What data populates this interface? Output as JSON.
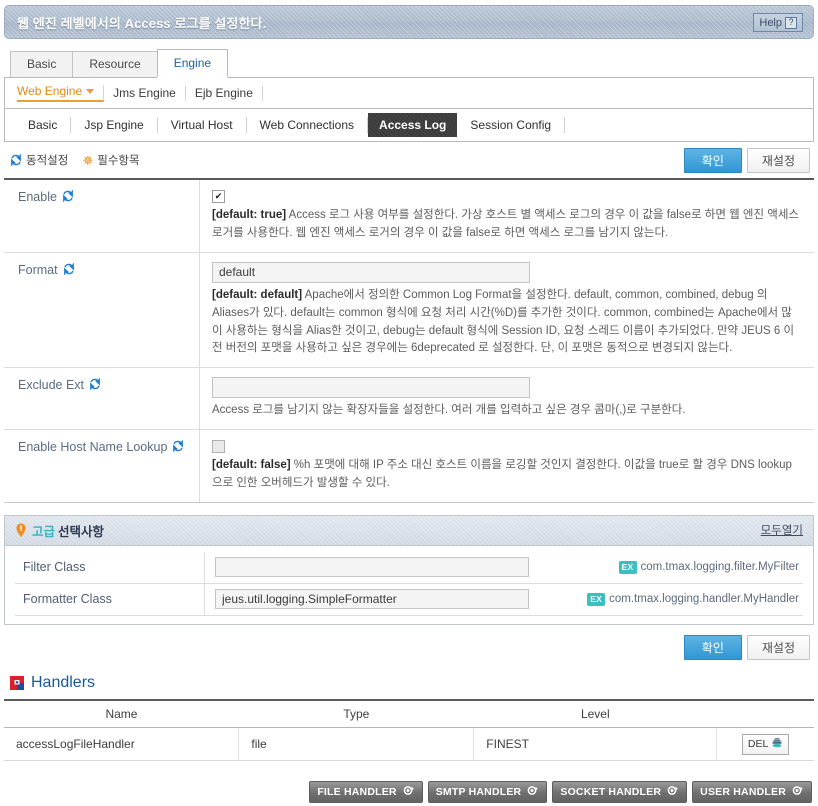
{
  "banner": {
    "title": "웹 엔진 레벨에서의 Access 로그를 설정한다.",
    "help_label": "Help",
    "help_icon_char": "?"
  },
  "main_tabs": [
    {
      "label": "Basic",
      "active": false
    },
    {
      "label": "Resource",
      "active": false
    },
    {
      "label": "Engine",
      "active": true
    }
  ],
  "engine_nav": [
    {
      "label": "Web Engine",
      "active": true
    },
    {
      "label": "Jms Engine",
      "active": false
    },
    {
      "label": "Ejb Engine",
      "active": false
    }
  ],
  "sub_tabs": [
    {
      "label": "Basic",
      "active": false
    },
    {
      "label": "Jsp Engine",
      "active": false
    },
    {
      "label": "Virtual Host",
      "active": false
    },
    {
      "label": "Web Connections",
      "active": false
    },
    {
      "label": "Access Log",
      "active": true
    },
    {
      "label": "Session Config",
      "active": false
    }
  ],
  "legend": {
    "dynamic_label": "동적설정",
    "required_label": "필수항목",
    "sync_icon": "sync-icon",
    "asterisk_icon": "asterisk-icon"
  },
  "actions": {
    "confirm_label": "확인",
    "reset_label": "재설정"
  },
  "form_rows": [
    {
      "label": "Enable",
      "control": "checkbox",
      "checked": true,
      "default_tag": "[default: true]",
      "description": "Access 로그 사용 여부를 설정한다. 가상 호스트 별 액세스 로그의 경우 이 값을 false로 하면 웹 엔진 액세스 로거를 사용한다. 웹 엔진 액세스 로거의 경우 이 값을 false로 하면 액세스 로그를 남기지 않는다."
    },
    {
      "label": "Format",
      "control": "text",
      "value": "default",
      "default_tag": "[default: default]",
      "description": "Apache에서 정의한 Common Log Format을 설정한다. default, common, combined, debug 의 Aliases가 있다. default는 common 형식에 요청 처리 시간(%D)를 추가한 것이다. common, combined는 Apache에서 많이 사용하는 형식을 Alias한 것이고, debug는 default 형식에 Session ID, 요청 스레드 이름이 추가되었다. 만약 JEUS 6 이전 버전의 포맷을 사용하고 싶은 경우에는 6deprecated 로 설정한다. 단, 이 포맷은 동적으로 변경되지 않는다."
    },
    {
      "label": "Exclude Ext",
      "control": "text",
      "value": "",
      "default_tag": "",
      "description": "Access 로그를 남기지 않는 확장자들을 설정한다. 여러 개를 입력하고 싶은 경우 콤마(,)로 구분한다."
    },
    {
      "label": "Enable Host Name Lookup",
      "control": "checkbox",
      "checked": false,
      "default_tag": "[default: false]",
      "description": "%h 포맷에 대해 IP 주소 대신 호스트 이름을 로깅할 것인지 결정한다. 이값을 true로 할 경우 DNS lookup으로 인한 오버헤드가 발생할 수 있다."
    }
  ],
  "advanced": {
    "title_accent": "고급",
    "title_rest": "선택사항",
    "open_all_label": "모두열기",
    "pin_icon": "bulb-pin-icon",
    "rows": [
      {
        "label": "Filter Class",
        "value": "",
        "hint_badge": "EX",
        "hint": "com.tmax.logging.filter.MyFilter"
      },
      {
        "label": "Formatter Class",
        "value": "jeus.util.logging.SimpleFormatter",
        "hint_badge": "EX",
        "hint": "com.tmax.logging.handler.MyHandler"
      }
    ]
  },
  "handlers": {
    "title": "Handlers",
    "logo_icon": "tmax-square-icon",
    "columns": [
      "Name",
      "Type",
      "Level",
      ""
    ],
    "rows": [
      {
        "name": "accessLogFileHandler",
        "type": "file",
        "level": "FINEST",
        "delete_label": "DEL",
        "delete_icon": "trash-icon"
      }
    ],
    "buttons": [
      {
        "label": "FILE HANDLER",
        "icon": "add-circle-icon"
      },
      {
        "label": "SMTP HANDLER",
        "icon": "add-circle-icon"
      },
      {
        "label": "SOCKET HANDLER",
        "icon": "add-circle-icon"
      },
      {
        "label": "USER HANDLER",
        "icon": "add-circle-icon"
      }
    ]
  },
  "colors": {
    "accent_blue": "#2f97d4",
    "orange": "#e8a033",
    "teal": "#3dbfbf",
    "handler_title": "#17599c",
    "label_blue": "#5b6b80"
  }
}
